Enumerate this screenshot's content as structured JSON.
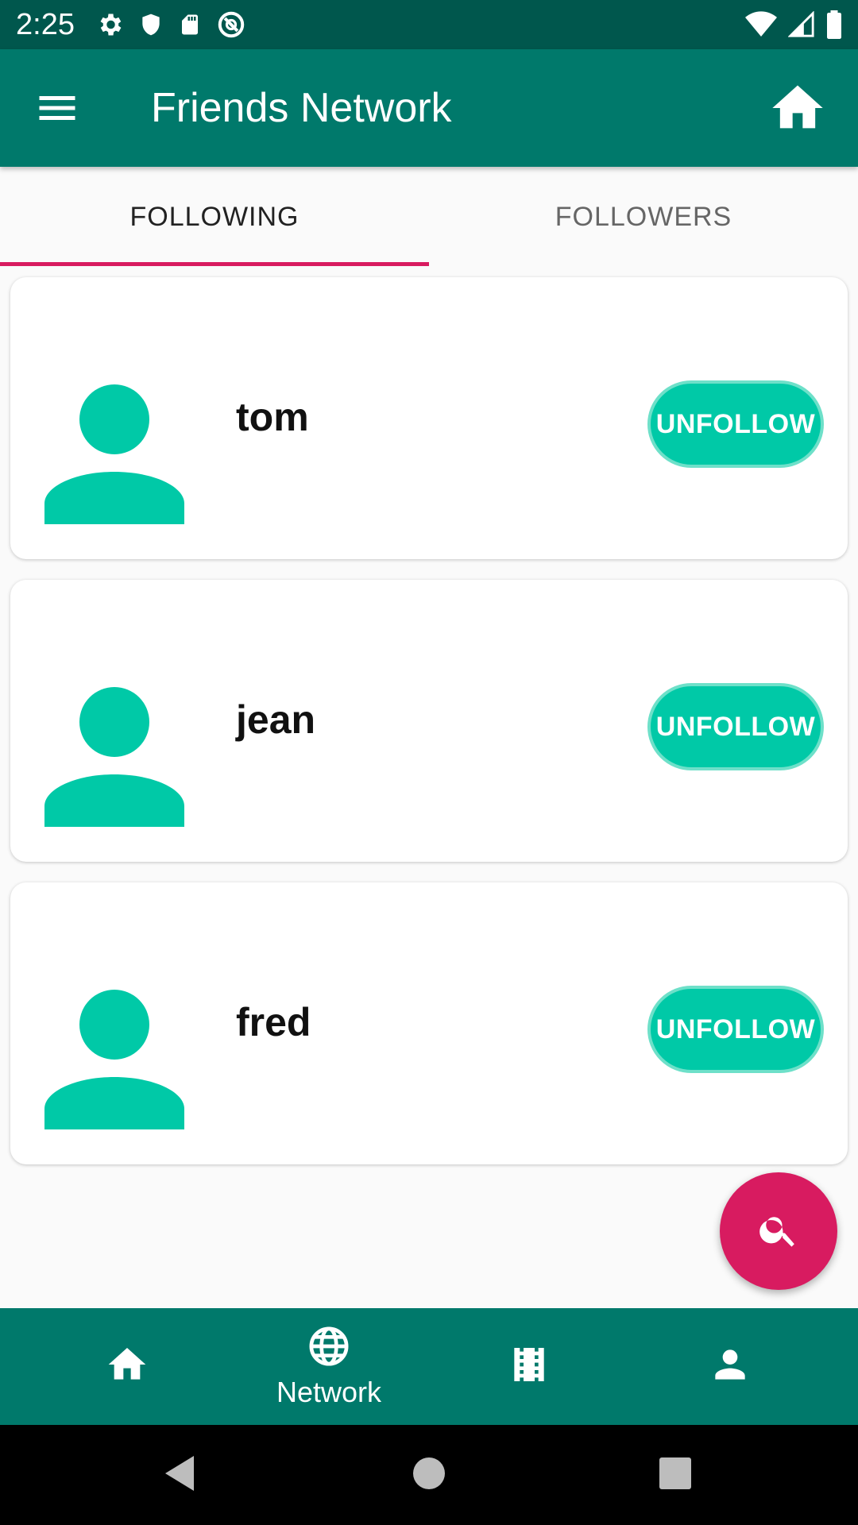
{
  "status_bar": {
    "time": "2:25",
    "left_icons": [
      "settings-icon",
      "shield-icon",
      "sd-card-icon",
      "no-sync-icon"
    ],
    "right_icons": [
      "wifi-icon",
      "signal-icon",
      "battery-icon"
    ]
  },
  "app_bar": {
    "title": "Friends Network",
    "menu_icon": "hamburger-menu-icon",
    "home_icon": "home-icon"
  },
  "tabs": [
    {
      "label": "FOLLOWING",
      "selected": true
    },
    {
      "label": "FOLLOWERS",
      "selected": false
    }
  ],
  "users": [
    {
      "name": "tom",
      "action": "UNFOLLOW"
    },
    {
      "name": "jean",
      "action": "UNFOLLOW"
    },
    {
      "name": "fred",
      "action": "UNFOLLOW"
    }
  ],
  "fab": {
    "icon": "search-icon"
  },
  "bottom_nav": {
    "items": [
      {
        "icon": "home-icon",
        "label": ""
      },
      {
        "icon": "globe-icon",
        "label": "Network"
      },
      {
        "icon": "film-icon",
        "label": ""
      },
      {
        "icon": "person-icon",
        "label": ""
      }
    ],
    "selected": 1
  },
  "colors": {
    "status_bar": "#00574d",
    "primary": "#00796b",
    "accent": "#d81b60",
    "button": "#00c9a7"
  }
}
